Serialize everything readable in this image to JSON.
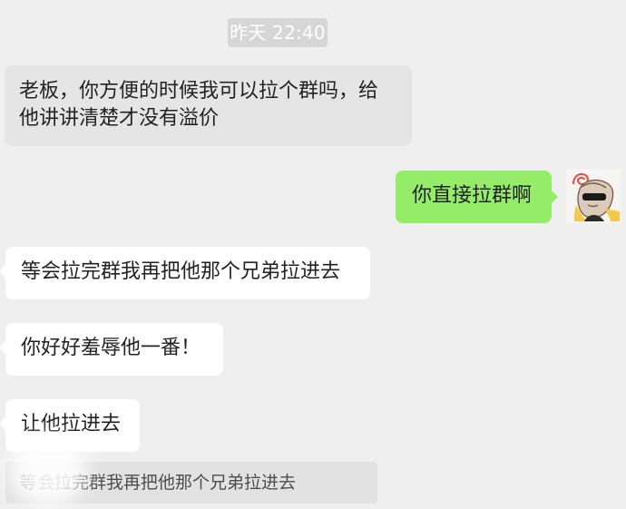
{
  "conversation": {
    "timestamp": "昨天 22:40",
    "messages": [
      {
        "text": "老板，你方便的时候我可以拉个群吗，给他讲讲清楚才没有溢价"
      },
      {
        "text": "你直接拉群啊"
      },
      {
        "text": "等会拉完群我再把他那个兄弟拉进去"
      },
      {
        "text": "你好好羞辱他一番！"
      },
      {
        "text": "让他拉进去"
      }
    ]
  },
  "composer": {
    "value": "等会拉完群我再把他那个兄弟拉进去"
  },
  "colors": {
    "background": "#efefef",
    "incoming_bubble": "#ffffff",
    "outgoing_bubble": "#95ec69",
    "quoted_bubble": "#e5e5e5"
  },
  "icons": {
    "avatar": "cartoon-avatar-icon"
  }
}
